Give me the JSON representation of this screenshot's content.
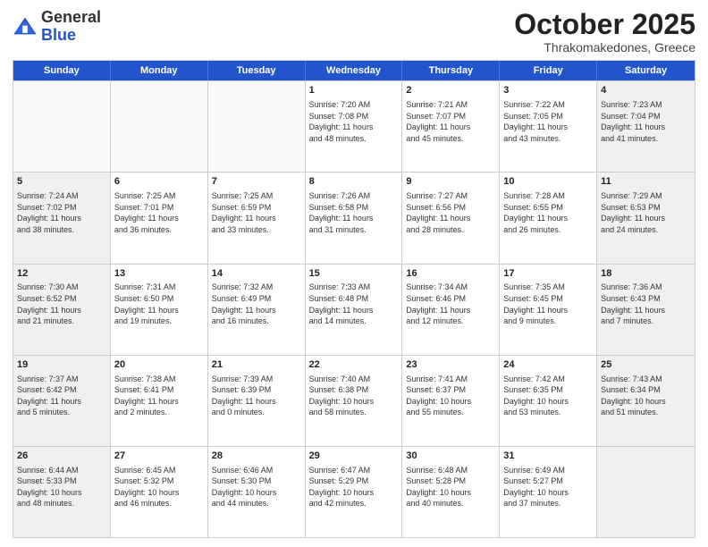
{
  "logo": {
    "line1": "General",
    "line2": "Blue"
  },
  "header": {
    "month": "October 2025",
    "location": "Thrakomakedones, Greece"
  },
  "dayNames": [
    "Sunday",
    "Monday",
    "Tuesday",
    "Wednesday",
    "Thursday",
    "Friday",
    "Saturday"
  ],
  "weeks": [
    [
      {
        "day": "",
        "info": "",
        "empty": true
      },
      {
        "day": "",
        "info": "",
        "empty": true
      },
      {
        "day": "",
        "info": "",
        "empty": true
      },
      {
        "day": "1",
        "info": "Sunrise: 7:20 AM\nSunset: 7:08 PM\nDaylight: 11 hours\nand 48 minutes."
      },
      {
        "day": "2",
        "info": "Sunrise: 7:21 AM\nSunset: 7:07 PM\nDaylight: 11 hours\nand 45 minutes."
      },
      {
        "day": "3",
        "info": "Sunrise: 7:22 AM\nSunset: 7:05 PM\nDaylight: 11 hours\nand 43 minutes."
      },
      {
        "day": "4",
        "info": "Sunrise: 7:23 AM\nSunset: 7:04 PM\nDaylight: 11 hours\nand 41 minutes.",
        "shaded": true
      }
    ],
    [
      {
        "day": "5",
        "info": "Sunrise: 7:24 AM\nSunset: 7:02 PM\nDaylight: 11 hours\nand 38 minutes.",
        "shaded": true
      },
      {
        "day": "6",
        "info": "Sunrise: 7:25 AM\nSunset: 7:01 PM\nDaylight: 11 hours\nand 36 minutes."
      },
      {
        "day": "7",
        "info": "Sunrise: 7:25 AM\nSunset: 6:59 PM\nDaylight: 11 hours\nand 33 minutes."
      },
      {
        "day": "8",
        "info": "Sunrise: 7:26 AM\nSunset: 6:58 PM\nDaylight: 11 hours\nand 31 minutes."
      },
      {
        "day": "9",
        "info": "Sunrise: 7:27 AM\nSunset: 6:56 PM\nDaylight: 11 hours\nand 28 minutes."
      },
      {
        "day": "10",
        "info": "Sunrise: 7:28 AM\nSunset: 6:55 PM\nDaylight: 11 hours\nand 26 minutes."
      },
      {
        "day": "11",
        "info": "Sunrise: 7:29 AM\nSunset: 6:53 PM\nDaylight: 11 hours\nand 24 minutes.",
        "shaded": true
      }
    ],
    [
      {
        "day": "12",
        "info": "Sunrise: 7:30 AM\nSunset: 6:52 PM\nDaylight: 11 hours\nand 21 minutes.",
        "shaded": true
      },
      {
        "day": "13",
        "info": "Sunrise: 7:31 AM\nSunset: 6:50 PM\nDaylight: 11 hours\nand 19 minutes."
      },
      {
        "day": "14",
        "info": "Sunrise: 7:32 AM\nSunset: 6:49 PM\nDaylight: 11 hours\nand 16 minutes."
      },
      {
        "day": "15",
        "info": "Sunrise: 7:33 AM\nSunset: 6:48 PM\nDaylight: 11 hours\nand 14 minutes."
      },
      {
        "day": "16",
        "info": "Sunrise: 7:34 AM\nSunset: 6:46 PM\nDaylight: 11 hours\nand 12 minutes."
      },
      {
        "day": "17",
        "info": "Sunrise: 7:35 AM\nSunset: 6:45 PM\nDaylight: 11 hours\nand 9 minutes."
      },
      {
        "day": "18",
        "info": "Sunrise: 7:36 AM\nSunset: 6:43 PM\nDaylight: 11 hours\nand 7 minutes.",
        "shaded": true
      }
    ],
    [
      {
        "day": "19",
        "info": "Sunrise: 7:37 AM\nSunset: 6:42 PM\nDaylight: 11 hours\nand 5 minutes.",
        "shaded": true
      },
      {
        "day": "20",
        "info": "Sunrise: 7:38 AM\nSunset: 6:41 PM\nDaylight: 11 hours\nand 2 minutes."
      },
      {
        "day": "21",
        "info": "Sunrise: 7:39 AM\nSunset: 6:39 PM\nDaylight: 11 hours\nand 0 minutes."
      },
      {
        "day": "22",
        "info": "Sunrise: 7:40 AM\nSunset: 6:38 PM\nDaylight: 10 hours\nand 58 minutes."
      },
      {
        "day": "23",
        "info": "Sunrise: 7:41 AM\nSunset: 6:37 PM\nDaylight: 10 hours\nand 55 minutes."
      },
      {
        "day": "24",
        "info": "Sunrise: 7:42 AM\nSunset: 6:35 PM\nDaylight: 10 hours\nand 53 minutes."
      },
      {
        "day": "25",
        "info": "Sunrise: 7:43 AM\nSunset: 6:34 PM\nDaylight: 10 hours\nand 51 minutes.",
        "shaded": true
      }
    ],
    [
      {
        "day": "26",
        "info": "Sunrise: 6:44 AM\nSunset: 5:33 PM\nDaylight: 10 hours\nand 48 minutes.",
        "shaded": true
      },
      {
        "day": "27",
        "info": "Sunrise: 6:45 AM\nSunset: 5:32 PM\nDaylight: 10 hours\nand 46 minutes."
      },
      {
        "day": "28",
        "info": "Sunrise: 6:46 AM\nSunset: 5:30 PM\nDaylight: 10 hours\nand 44 minutes."
      },
      {
        "day": "29",
        "info": "Sunrise: 6:47 AM\nSunset: 5:29 PM\nDaylight: 10 hours\nand 42 minutes."
      },
      {
        "day": "30",
        "info": "Sunrise: 6:48 AM\nSunset: 5:28 PM\nDaylight: 10 hours\nand 40 minutes."
      },
      {
        "day": "31",
        "info": "Sunrise: 6:49 AM\nSunset: 5:27 PM\nDaylight: 10 hours\nand 37 minutes."
      },
      {
        "day": "",
        "info": "",
        "empty": true,
        "shaded": true
      }
    ]
  ]
}
